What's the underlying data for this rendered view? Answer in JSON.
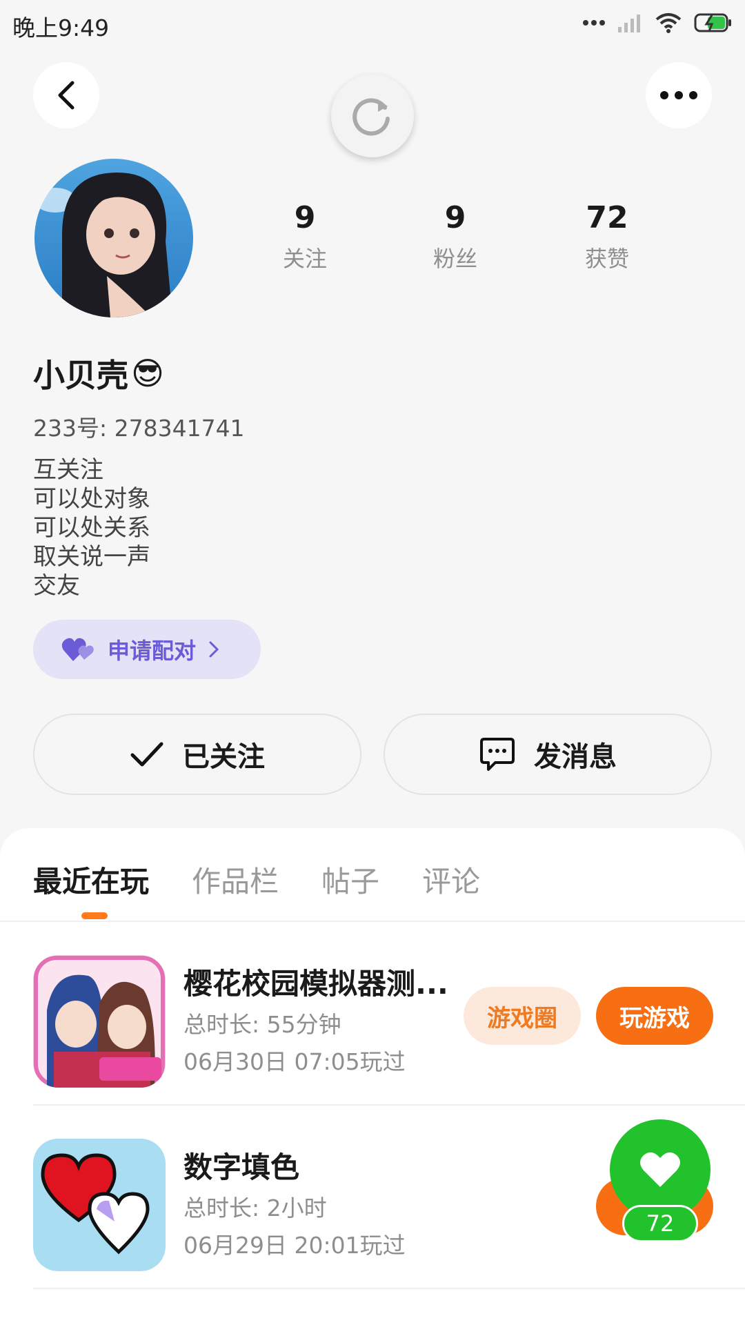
{
  "status_bar": {
    "time": "晚上9:49"
  },
  "profile": {
    "stats": [
      {
        "value": "9",
        "label": "关注"
      },
      {
        "value": "9",
        "label": "粉丝"
      },
      {
        "value": "72",
        "label": "获赞"
      }
    ],
    "username": "小贝壳",
    "username_emoji": "😎",
    "id_text": "233号: 278341741",
    "bio_lines": [
      "互关注",
      "可以处对象",
      "可以处关系",
      "取关说一声",
      "交友"
    ],
    "pair_button": "申请配对",
    "follow_button": "已关注",
    "message_button": "发消息"
  },
  "tabs": [
    "最近在玩",
    "作品栏",
    "帖子",
    "评论"
  ],
  "games": [
    {
      "name": "樱花校园模拟器测...",
      "duration": "总时长: 55分钟",
      "last_played": "06月30日 07:05玩过",
      "circle_button": "游戏圈",
      "play_button": "玩游戏"
    },
    {
      "name": "数字填色",
      "duration": "总时长: 2小时",
      "last_played": "06月29日 20:01玩过"
    }
  ],
  "floating_like": {
    "count": "72"
  },
  "colors": {
    "accent": "#f76f12",
    "pair_purple": "#6a5cd6",
    "like_green": "#22c22c"
  }
}
